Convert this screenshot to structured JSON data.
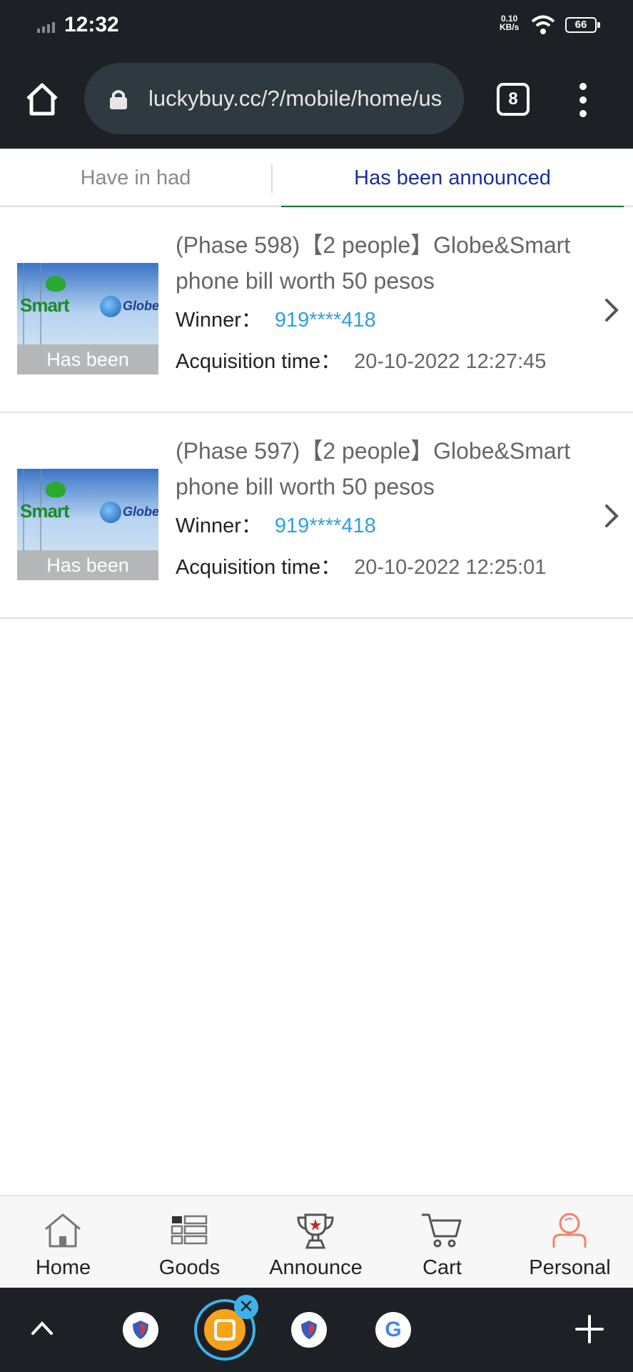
{
  "status_bar": {
    "time": "12:32",
    "net_speed_value": "0.10",
    "net_speed_unit": "KB/s",
    "battery": "66"
  },
  "browser": {
    "url": "luckybuy.cc/?/mobile/home/us",
    "tab_count": "8"
  },
  "tabs": [
    {
      "label": "Have in had",
      "active": false
    },
    {
      "label": "Has been announced",
      "active": true
    }
  ],
  "items": [
    {
      "title": "(Phase 598)【2 people】Globe&Smart phone bill worth 50 pesos",
      "thumb_brand_left": "Smart",
      "thumb_brand_right": "Globe",
      "thumb_status": "Has been",
      "winner_label": "Winner：",
      "winner_value": "919****418",
      "time_label": "Acquisition time：",
      "time_value": "20-10-2022 12:27:45"
    },
    {
      "title": "(Phase 597)【2 people】Globe&Smart phone bill worth 50 pesos",
      "thumb_brand_left": "Smart",
      "thumb_brand_right": "Globe",
      "thumb_status": "Has been",
      "winner_label": "Winner：",
      "winner_value": "919****418",
      "time_label": "Acquisition time：",
      "time_value": "20-10-2022 12:25:01"
    }
  ],
  "bottom_nav": [
    {
      "label": "Home",
      "icon": "house-icon"
    },
    {
      "label": "Goods",
      "icon": "grid-list-icon"
    },
    {
      "label": "Announce",
      "icon": "trophy-icon"
    },
    {
      "label": "Cart",
      "icon": "cart-icon"
    },
    {
      "label": "Personal",
      "icon": "user-icon"
    }
  ],
  "tab_switcher": {
    "google_letter": "G"
  },
  "colors": {
    "active_tab_text": "#1a2f9a",
    "active_tab_underline": "#15793a",
    "winner_value": "#2ea0df",
    "personal_icon": "#f2836b",
    "browser_chrome": "#1d2125"
  }
}
